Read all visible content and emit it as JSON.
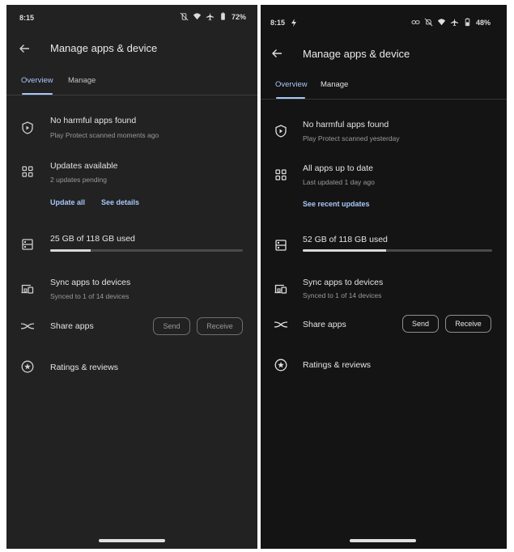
{
  "left": {
    "status": {
      "time": "8:15",
      "battery": "72%"
    },
    "title": "Manage apps & device",
    "tabs": [
      {
        "label": "Overview"
      },
      {
        "label": "Manage"
      }
    ],
    "protect": {
      "title": "No harmful apps found",
      "subtitle": "Play Protect scanned moments ago"
    },
    "updates": {
      "title": "Updates available",
      "subtitle": "2 updates pending",
      "link1": "Update all",
      "link2": "See details"
    },
    "storage": {
      "title": "25 GB of 118 GB used",
      "fraction": 0.21
    },
    "sync": {
      "title": "Sync apps to devices",
      "subtitle": "Synced to 1 of 14 devices"
    },
    "share": {
      "title": "Share apps",
      "send": "Send",
      "receive": "Receive"
    },
    "ratings": {
      "title": "Ratings & reviews"
    }
  },
  "right": {
    "status": {
      "time": "8:15",
      "battery": "48%"
    },
    "title": "Manage apps & device",
    "tabs": [
      {
        "label": "Overview"
      },
      {
        "label": "Manage"
      }
    ],
    "protect": {
      "title": "No harmful apps found",
      "subtitle": "Play Protect scanned yesterday"
    },
    "updates": {
      "title": "All apps up to date",
      "subtitle": "Last updated 1 day ago",
      "link1": "See recent updates"
    },
    "storage": {
      "title": "52 GB of 118 GB used",
      "fraction": 0.44
    },
    "sync": {
      "title": "Sync apps to devices",
      "subtitle": "Synced to 1 of 14 devices"
    },
    "share": {
      "title": "Share apps",
      "send": "Send",
      "receive": "Receive"
    },
    "ratings": {
      "title": "Ratings & reviews"
    }
  },
  "colors": {
    "accent": "#a8c7fa",
    "left_bg": "#222222",
    "right_bg": "#141414"
  }
}
